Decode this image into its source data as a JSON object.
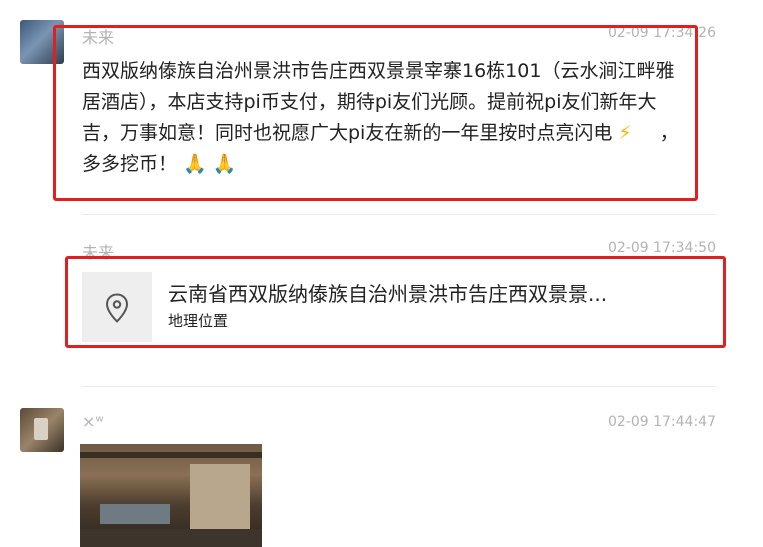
{
  "messages": [
    {
      "sender": "未来",
      "time": "02-09 17:34:26",
      "text": "西双版纳傣族自治州景洪市告庄西双景景宰寨16栋101（云水涧江畔雅居酒店），本店支持pi币支付，期待pi友们光顾。提前祝pi友们新年大吉，万事如意！同时也祝愿广大pi友在新的一年里按时点亮闪电",
      "tail": "，多多挖币！",
      "emojis": [
        "high-voltage",
        "folded-hands",
        "folded-hands"
      ]
    },
    {
      "sender": "未来",
      "time": "02-09 17:34:50",
      "location": {
        "name": "云南省西双版纳傣族自治州景洪市告庄西双景景...",
        "label": "地理位置",
        "icon": "location-pin-icon"
      }
    },
    {
      "sender": "×ʷ",
      "time": "02-09 17:44:47",
      "attachment": "photo"
    }
  ],
  "colors": {
    "highlight": "#e02020",
    "meta_text": "#b3b3b3",
    "body_text": "#222222",
    "location_icon_bg": "#eeeeee"
  }
}
